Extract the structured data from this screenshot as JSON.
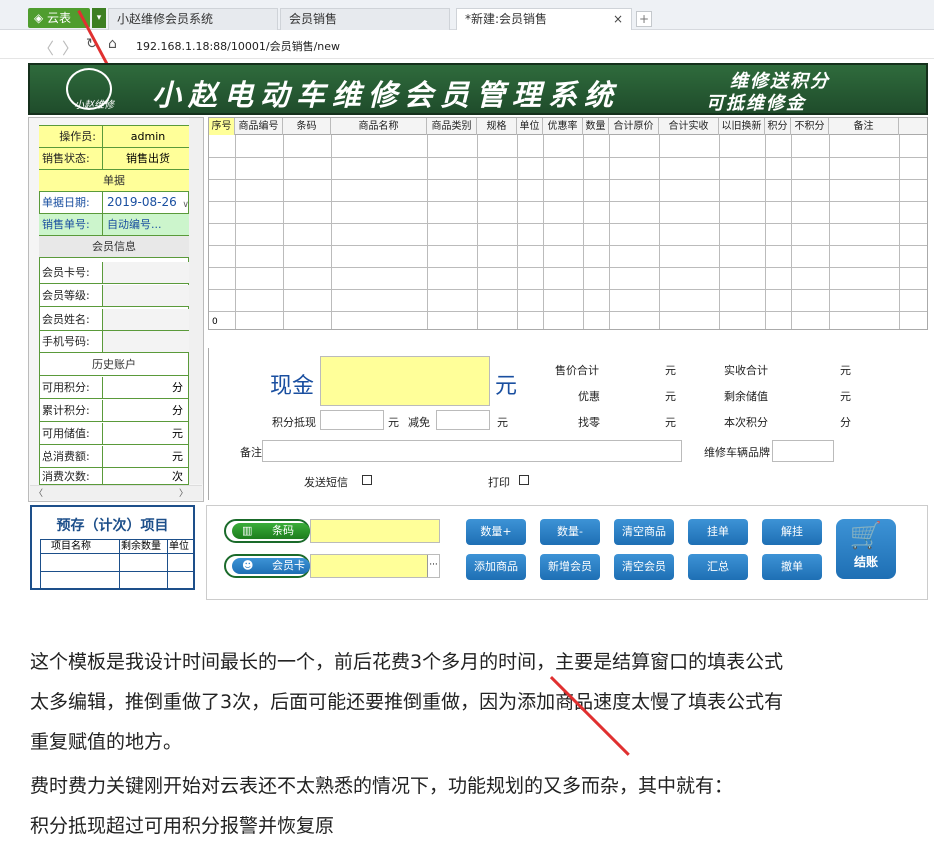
{
  "browser": {
    "app_tab": "云表",
    "tabs": [
      {
        "label": "小赵维修会员系统"
      },
      {
        "label": "会员销售"
      },
      {
        "label": "*新建:会员销售"
      }
    ],
    "close_glyph": "×",
    "address": "192.168.1.18:88/10001/会员销售/new"
  },
  "banner": {
    "title": "小赵电动车维修会员管理系统",
    "logo_text": "小赵维修",
    "slogan_line1": "维修送积分",
    "slogan_line2": "可抵维修金"
  },
  "left_panel": {
    "operator_label": "操作员:",
    "operator_value": "admin",
    "status_label": "销售状态:",
    "status_value": "销售出货",
    "document_section": "单据",
    "date_label": "单据日期:",
    "date_value": "2019-08-26",
    "number_label": "销售单号:",
    "number_value": "自动编号...",
    "member_section": "会员信息",
    "card_label": "会员卡号:",
    "level_label": "会员等级:",
    "name_label": "会员姓名:",
    "phone_label": "手机号码:",
    "history_section": "历史账户",
    "points_label": "可用积分:",
    "points_unit": "分",
    "accum_label": "累计积分:",
    "accum_unit": "分",
    "stored_label": "可用储值:",
    "stored_unit": "元",
    "total_label": "总消费额:",
    "total_unit": "元",
    "times_label": "消费次数:",
    "times_unit": "次"
  },
  "grid": {
    "columns": [
      "序号",
      "商品编号",
      "条码",
      "商品名称",
      "商品类别",
      "规格",
      "单位",
      "优惠率",
      "数量",
      "合计原价",
      "合计实收",
      "以旧换新",
      "积分",
      "不积分",
      "备注"
    ],
    "total_row_value": "0"
  },
  "form": {
    "cash_label": "现金",
    "cash_unit": "元",
    "points_redeem_label": "积分抵现",
    "unit_yuan": "元",
    "reduce_label": "减免",
    "sale_total_label": "售价合计",
    "discount_label": "优惠",
    "change_label": "找零",
    "actual_label": "实收合计",
    "remaining_label": "剩余储值",
    "this_points_label": "本次积分",
    "points_unit": "分",
    "remark_label": "备注",
    "plate_label": "维修车辆品牌",
    "sms_label": "发送短信",
    "print_label": "打印"
  },
  "presave": {
    "title": "预存（计次）项目",
    "columns": [
      "项目名称",
      "剩余数量",
      "单位"
    ]
  },
  "actions": {
    "barcode_label": "条码",
    "member_card_label": "会员卡",
    "qty_plus": "数量+",
    "qty_minus": "数量-",
    "clear_goods": "清空商品",
    "hang": "挂单",
    "unhang": "解挂",
    "add_goods": "添加商品",
    "add_member": "新增会员",
    "clear_member": "清空会员",
    "summary": "汇总",
    "cancel": "撤单",
    "checkout": "结账",
    "ellipsis": "···"
  },
  "article": {
    "line1": "这个模板是我设计时间最长的一个，前后花费3个多月的时间，主要是结算窗口的填表公式",
    "line2": "太多编辑，推倒重做了3次，后面可能还要推倒重做，因为添加商品速度太慢了填表公式有",
    "line3": "重复赋值的地方。",
    "line4": "费时费力关键刚开始对云表还不太熟悉的情况下，功能规划的又多而杂，其中就有：",
    "line5": "积分抵现超过可用积分报警并恢复原"
  },
  "colors": {
    "accent_green": "#4f9d2e",
    "banner": "#2f6b3c",
    "button_blue": "#1e6fb4",
    "input_yellow": "#ffff99",
    "annotation_red": "#e03030"
  },
  "icons": [
    "diamond-icon",
    "back-arrow-icon",
    "forward-arrow-icon",
    "refresh-icon",
    "home-icon",
    "barcode-icon",
    "member-icon",
    "cart-icon"
  ]
}
